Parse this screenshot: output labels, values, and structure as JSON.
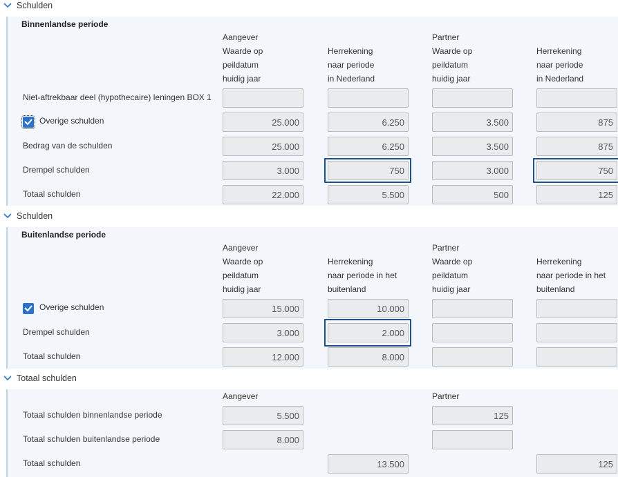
{
  "section1": {
    "header": "Schulden",
    "subtitle": "Binnenlandse periode",
    "col_headers": {
      "c1": [
        "Aangever",
        "Waarde op",
        "peildatum",
        "huidig jaar"
      ],
      "c2": [
        "Herrekening",
        "naar periode",
        "in Nederland"
      ],
      "c3": [
        "Partner",
        "Waarde op",
        "peildatum",
        "huidig jaar"
      ],
      "c4": [
        "Herrekening",
        "naar periode",
        "in Nederland"
      ]
    },
    "rows": [
      {
        "label": "Niet-aftrekbaar deel (hypothecaire) leningen BOX 1",
        "values": [
          "",
          "",
          "",
          ""
        ]
      },
      {
        "label": "Overige schulden",
        "values": [
          "25.000",
          "6.250",
          "3.500",
          "875"
        ]
      },
      {
        "label": "Bedrag van de schulden",
        "values": [
          "25.000",
          "6.250",
          "3.500",
          "875"
        ]
      },
      {
        "label": "Drempel schulden",
        "values": [
          "3.000",
          "750",
          "3.000",
          "750"
        ]
      },
      {
        "label": "Totaal schulden",
        "values": [
          "22.000",
          "5.500",
          "500",
          "125"
        ]
      }
    ]
  },
  "section2": {
    "header": "Schulden",
    "subtitle": "Buitenlandse periode",
    "col_headers": {
      "c1": [
        "Aangever",
        "Waarde op",
        "peildatum",
        "huidig jaar"
      ],
      "c2": [
        "Herrekening",
        "naar periode in het",
        "buitenland"
      ],
      "c3": [
        "Partner",
        "Waarde op",
        "peildatum",
        "huidig jaar"
      ],
      "c4": [
        "Herrekening",
        "naar periode in het",
        "buitenland"
      ]
    },
    "rows": [
      {
        "label": "Overige schulden",
        "values": [
          "15.000",
          "10.000",
          "",
          ""
        ]
      },
      {
        "label": "Drempel schulden",
        "values": [
          "3.000",
          "2.000",
          "",
          ""
        ]
      },
      {
        "label": "Totaal schulden",
        "values": [
          "12.000",
          "8.000",
          "",
          ""
        ]
      }
    ]
  },
  "section3": {
    "header": "Totaal schulden",
    "col_headers": {
      "c1": "Aangever",
      "c3": "Partner"
    },
    "rows": [
      {
        "label": "Totaal schulden binnenlandse periode",
        "values": [
          "5.500",
          "125"
        ]
      },
      {
        "label": "Totaal schulden buitenlandse periode",
        "values": [
          "8.000",
          ""
        ]
      },
      {
        "label": "Totaal schulden",
        "values": [
          "13.500",
          "125"
        ]
      }
    ]
  },
  "icons": {
    "section_toggle": "chevron-down-icon",
    "checkbox": "checkmark-icon"
  },
  "colors": {
    "accent": "#2b73c8",
    "focus_border": "#1f5086",
    "panel_bg": "#f3f7fb",
    "panel_rule": "#bcd3e6",
    "field_bg": "#e9ebed"
  }
}
